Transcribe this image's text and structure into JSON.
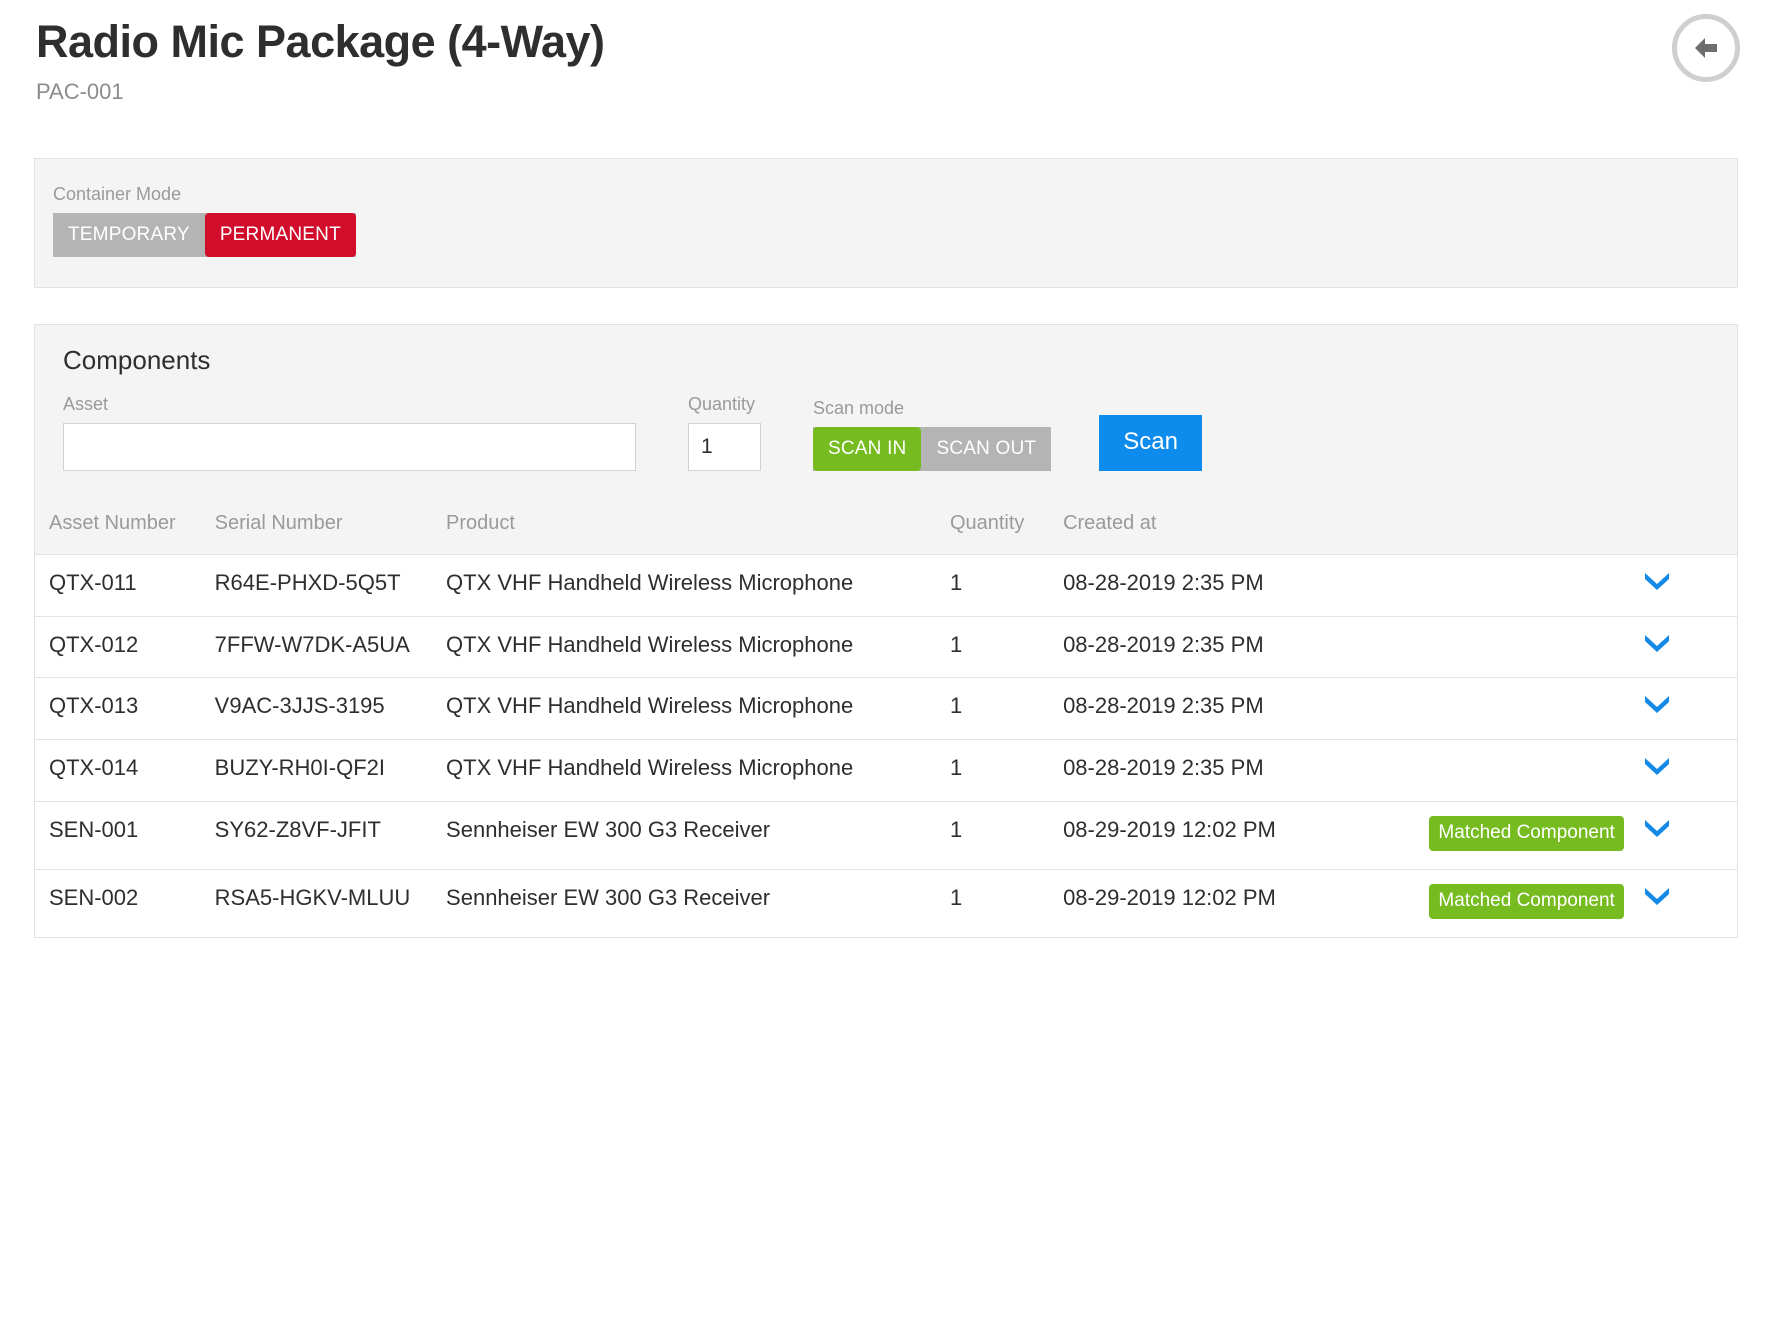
{
  "header": {
    "title": "Radio Mic Package (4-Way)",
    "subtitle": "PAC-001",
    "back_icon": "arrow-left-icon"
  },
  "container_mode": {
    "label": "Container Mode",
    "options": [
      "TEMPORARY",
      "PERMANENT"
    ],
    "selected": "PERMANENT",
    "active_color": "#d10d2b",
    "inactive_color": "#b4b4b4"
  },
  "components": {
    "title": "Components",
    "asset": {
      "label": "Asset",
      "value": "",
      "placeholder": ""
    },
    "quantity": {
      "label": "Quantity",
      "value": "1"
    },
    "scan_mode": {
      "label": "Scan mode",
      "options": [
        "SCAN IN",
        "SCAN OUT"
      ],
      "selected": "SCAN IN",
      "active_color": "#76bc21",
      "inactive_color": "#b4b4b4"
    },
    "scan_button": {
      "label": "Scan",
      "color": "#0d8ced"
    }
  },
  "table": {
    "columns": [
      "Asset Number",
      "Serial Number",
      "Product",
      "Quantity",
      "Created at"
    ],
    "rows": [
      {
        "asset_number": "QTX-011",
        "serial_number": "R64E-PHXD-5Q5T",
        "product": "QTX VHF Handheld Wireless Microphone",
        "quantity": "1",
        "created_at": "08-28-2019 2:35 PM",
        "flag": "",
        "chevron": "chevron-down-icon"
      },
      {
        "asset_number": "QTX-012",
        "serial_number": "7FFW-W7DK-A5UA",
        "product": "QTX VHF Handheld Wireless Microphone",
        "quantity": "1",
        "created_at": "08-28-2019 2:35 PM",
        "flag": "",
        "chevron": "chevron-down-icon"
      },
      {
        "asset_number": "QTX-013",
        "serial_number": "V9AC-3JJS-3195",
        "product": "QTX VHF Handheld Wireless Microphone",
        "quantity": "1",
        "created_at": "08-28-2019 2:35 PM",
        "flag": "",
        "chevron": "chevron-down-icon"
      },
      {
        "asset_number": "QTX-014",
        "serial_number": "BUZY-RH0I-QF2I",
        "product": "QTX VHF Handheld Wireless Microphone",
        "quantity": "1",
        "created_at": "08-28-2019 2:35 PM",
        "flag": "",
        "chevron": "chevron-down-icon"
      },
      {
        "asset_number": "SEN-001",
        "serial_number": "SY62-Z8VF-JFIT",
        "product": "Sennheiser EW 300 G3 Receiver",
        "quantity": "1",
        "created_at": "08-29-2019 12:02 PM",
        "flag": "Matched Component",
        "chevron": "chevron-down-icon"
      },
      {
        "asset_number": "SEN-002",
        "serial_number": "RSA5-HGKV-MLUU",
        "product": "Sennheiser EW 300 G3 Receiver",
        "quantity": "1",
        "created_at": "08-29-2019 12:02 PM",
        "flag": "Matched Component",
        "chevron": "chevron-down-icon"
      }
    ]
  }
}
